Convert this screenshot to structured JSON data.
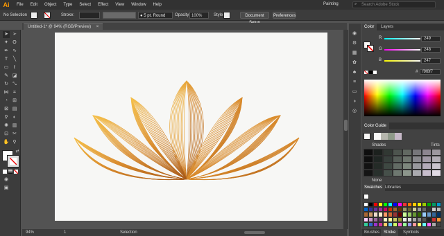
{
  "app": {
    "logo": "Ai"
  },
  "menu": [
    "File",
    "Edit",
    "Object",
    "Type",
    "Select",
    "Effect",
    "View",
    "Window",
    "Help"
  ],
  "workspace": "Painting",
  "search": {
    "placeholder": "Search Adobe Stock"
  },
  "control": {
    "selection_label": "No Selection",
    "stroke_label": "Stroke:",
    "brush_label": "5 pt. Round",
    "opacity_label": "Opacity:",
    "opacity_value": "100%",
    "style_label": "Style:",
    "doc_setup": "Document Setup",
    "preferences": "Preferences"
  },
  "document": {
    "tab": "Untitled-1* @ 94% (RGB/Preview)",
    "close": "×"
  },
  "status": {
    "zoom": "94%",
    "tool": "Selection",
    "page": "1"
  },
  "color_panel": {
    "tabs": [
      "Color",
      "Layers"
    ],
    "r_label": "R",
    "g_label": "G",
    "b_label": "B",
    "r": "249",
    "g": "248",
    "b": "247",
    "hex_label": "#",
    "hex": "f9f8f7"
  },
  "color_guide": {
    "title": "Color Guide",
    "shades": "Shades",
    "tints": "Tints",
    "none": "None"
  },
  "swatches_panel": {
    "tabs": [
      "Swatches",
      "Libraries"
    ]
  },
  "bottom_tabs": [
    "Brushes",
    "Stroke",
    "Symbols"
  ],
  "colors": {
    "accent": "#ff9a00",
    "lotus_light": "#f3b43f",
    "lotus_dark": "#b8691e"
  }
}
